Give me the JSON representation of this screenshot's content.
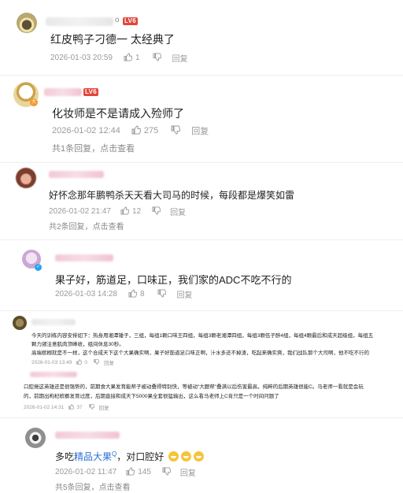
{
  "comments": [
    {
      "user_suffix": "o",
      "level": "LV6",
      "text": "红皮鸭子刁德一 太经典了",
      "date": "2026-01-03 20:59",
      "likes": "1",
      "reply_label": "回复"
    },
    {
      "level": "LV6",
      "text": "化妆师是不是请成入殓师了",
      "date": "2026-01-02 12:44",
      "likes": "275",
      "reply_label": "回复",
      "reply_summary": "共1条回复，",
      "view_label": "点击查看"
    },
    {
      "text": "好怀念那年鹏鸭杀天天看大司马的时候，每段都是爆笑如雷",
      "date": "2026-01-02 21:47",
      "likes": "12",
      "reply_label": "回复",
      "reply_summary": "共2条回复，",
      "view_label": "点击查看"
    },
    {
      "text": "果子好，筋道足，口味正，我们家的ADC不吃不行的",
      "date": "2026-01-03 14:28",
      "likes": "8",
      "reply_label": "回复"
    },
    {
      "text_line1": "今天的训练内容安排如下：热身用湘潭锤子，三组，每组1颗口味王四组，每组3颗老湘潭四组，每组3颗伍子醉4组，每组4颗最后和成天超级组，每组五",
      "text_line2": "颗力颌注意肌肉顶峰收，组间休息30秒。",
      "text_line3": "高端槟榔就是不一样，这个合成天下这个大果确实啊，果子好筋道足口味正啊，汁水多还不掉渣，吃起来确实爽，我们战队那个大司啊，他不吃不行的",
      "date": "2026-01-03 13:49",
      "likes": "0",
      "reply_label": "回复"
    },
    {
      "text_line1": "口腔癌这英雄还是很强势的，前期食大果发育能帮子被动叠得特别快，等被动\"大腮帮\"叠满以后伤害最高，纯粹的后期英雄很能C。马老师一看就是会玩",
      "text_line2": "的，前期出枸杞槟榔发育过度，后期直接和成天下5000果全套很猛输出，这么看马老师上C肯只是一个时间问题了",
      "date": "2026-01-02 14:31",
      "likes": "37",
      "reply_label": "回复"
    },
    {
      "text_before": "多吃",
      "text_link": "精品大果",
      "text_after": "，对口腔好",
      "date": "2026-01-02 11:47",
      "likes": "145",
      "reply_label": "回复",
      "reply_summary": "共5条回复，",
      "view_label": "点击查看"
    }
  ],
  "colors": {
    "level_badge": "#e2463b",
    "link": "#2b6fd6",
    "meta": "#9a9a9a"
  }
}
